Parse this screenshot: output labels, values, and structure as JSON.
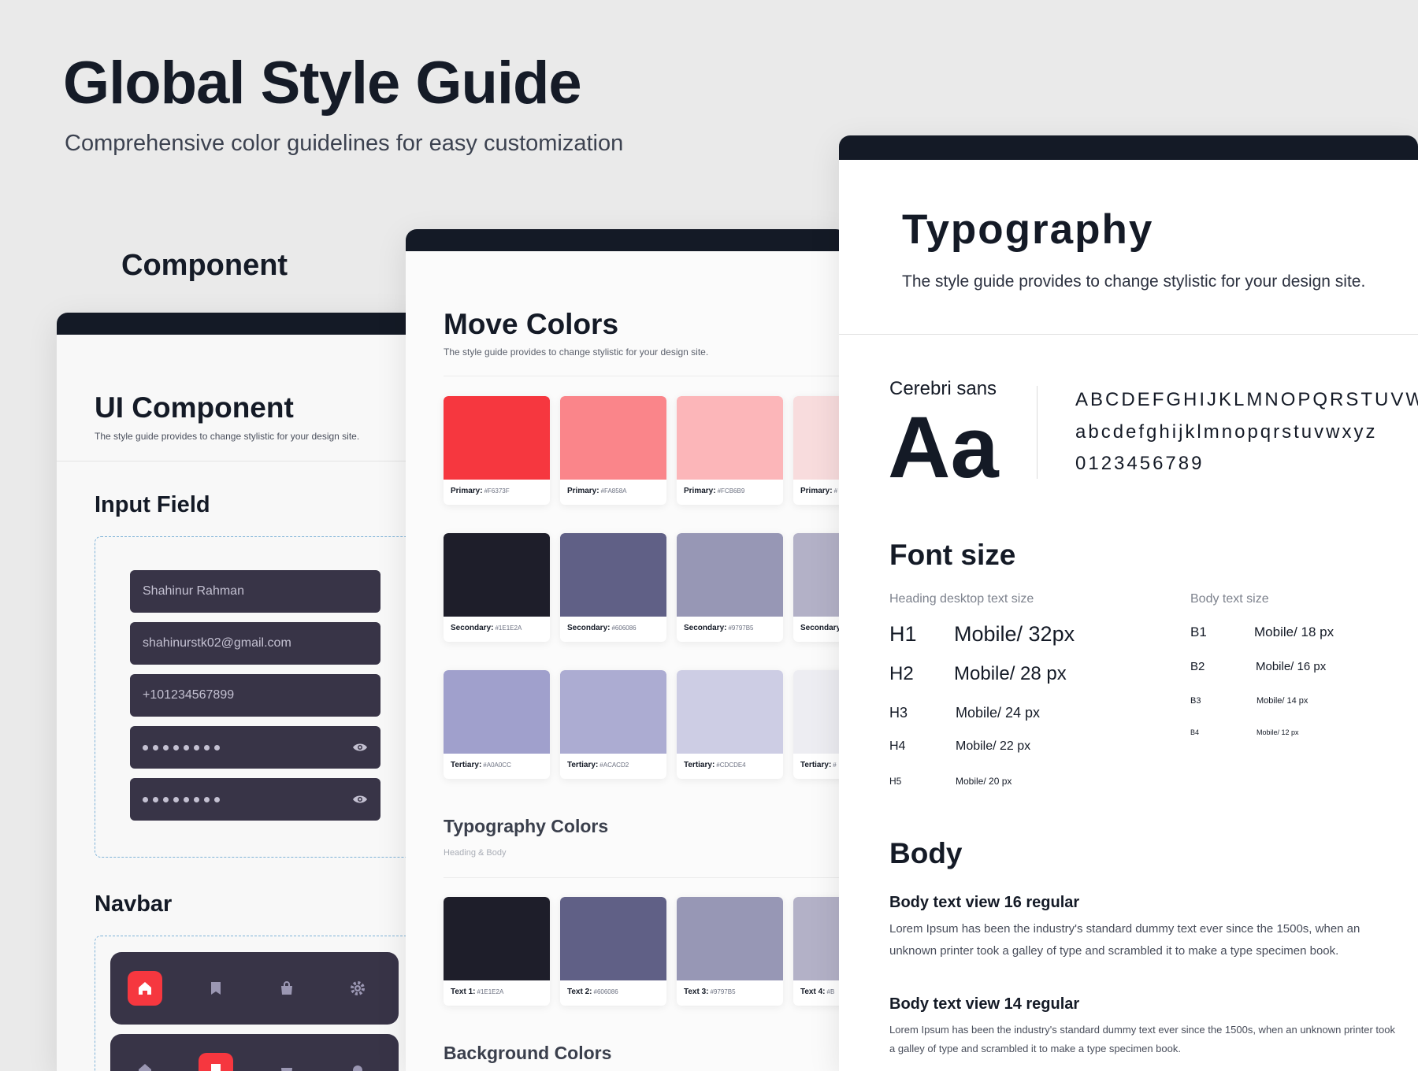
{
  "hero": {
    "title": "Global Style Guide",
    "subtitle": "Comprehensive color guidelines for easy customization",
    "component_label": "Component"
  },
  "component_panel": {
    "title": "UI Component",
    "description": "The style guide provides to change stylistic for your design site.",
    "input_section": "Input Field",
    "inputs": [
      {
        "value": "Shahinur Rahman"
      },
      {
        "value": "shahinurstk02@gmail.com"
      },
      {
        "value": "+101234567899"
      }
    ],
    "password_icon": "eye-icon",
    "navbar_section": "Navbar",
    "navbar_icons": [
      "home-icon",
      "bookmark-icon",
      "bag-icon",
      "gear-icon"
    ],
    "accent_color": "#F6373F",
    "field_color": "#383447"
  },
  "colors_panel": {
    "title": "Move Colors",
    "description": "The style guide provides to change stylistic for your design site.",
    "primary": [
      {
        "label": "Primary:",
        "hex": "#F6373F",
        "color": "#F6373F"
      },
      {
        "label": "Primary:",
        "hex": "#FA858A",
        "color": "#FA858A"
      },
      {
        "label": "Primary:",
        "hex": "#FCB6B9",
        "color": "#FCB6B9"
      },
      {
        "label": "Primary:",
        "hex": "#",
        "color": "#F8DCDD"
      }
    ],
    "secondary": [
      {
        "label": "Secondary:",
        "hex": "#1E1E2A",
        "color": "#1E1E2A"
      },
      {
        "label": "Secondary:",
        "hex": "#606086",
        "color": "#606086"
      },
      {
        "label": "Secondary:",
        "hex": "#9797B5",
        "color": "#9797B5"
      },
      {
        "label": "Secondary",
        "hex": "",
        "color": "#B3B1C7"
      }
    ],
    "tertiary": [
      {
        "label": "Tertiary:",
        "hex": "#A0A0CC",
        "color": "#A0A0CC"
      },
      {
        "label": "Tertiary:",
        "hex": "#ACACD2",
        "color": "#ACACD2"
      },
      {
        "label": "Tertiary:",
        "hex": "#CDCDE4",
        "color": "#CDCDE4"
      },
      {
        "label": "Tertiary:",
        "hex": "#",
        "color": "#EDEDF2"
      }
    ],
    "typography_title": "Typography Colors",
    "typography_sub": "Heading & Body",
    "text_colors": [
      {
        "label": "Text 1:",
        "hex": "#1E1E2A",
        "color": "#1E1E2A"
      },
      {
        "label": "Text 2:",
        "hex": "#606086",
        "color": "#606086"
      },
      {
        "label": "Text 3:",
        "hex": "#9797B5",
        "color": "#9797B5"
      },
      {
        "label": "Text 4:",
        "hex": "#B",
        "color": "#B3B1C7"
      }
    ],
    "background_title": "Background Colors"
  },
  "typography_panel": {
    "title": "Typography",
    "description": "The style guide provides to change stylistic for your design site.",
    "font_name": "Cerebri sans",
    "specimen": "Aa",
    "uppercase": "ABCDEFGHIJKLMNOPQRSTUVWX",
    "lowercase": "abcdefghijklmnopqrstuvwxyz",
    "digits": "0123456789",
    "font_size_title": "Font size",
    "heading_label": "Heading desktop text size",
    "body_label": "Body text size",
    "headings": [
      {
        "tag": "H1",
        "size": "Mobile/ 32px"
      },
      {
        "tag": "H2",
        "size": "Mobile/ 28 px"
      },
      {
        "tag": "H3",
        "size": "Mobile/ 24 px"
      },
      {
        "tag": "H4",
        "size": "Mobile/ 22 px"
      },
      {
        "tag": "H5",
        "size": "Mobile/ 20 px"
      }
    ],
    "bodies": [
      {
        "tag": "B1",
        "size": "Mobile/ 18 px"
      },
      {
        "tag": "B2",
        "size": "Mobile/ 16 px"
      },
      {
        "tag": "B3",
        "size": "Mobile/ 14 px"
      },
      {
        "tag": "B4",
        "size": "Mobile/ 12 px"
      }
    ],
    "body_title": "Body",
    "body16_title": "Body text view 16 regular",
    "body16_text": "Lorem Ipsum has been the industry's standard dummy text ever since the 1500s, when an unknown printer took a galley of  type and scrambled it to make a type specimen book.",
    "body14_title": "Body text view 14 regular",
    "body14_text": "Lorem Ipsum has been the industry's standard dummy text ever since the 1500s, when an unknown printer took a galley of  type and scrambled it to make a type specimen book."
  }
}
